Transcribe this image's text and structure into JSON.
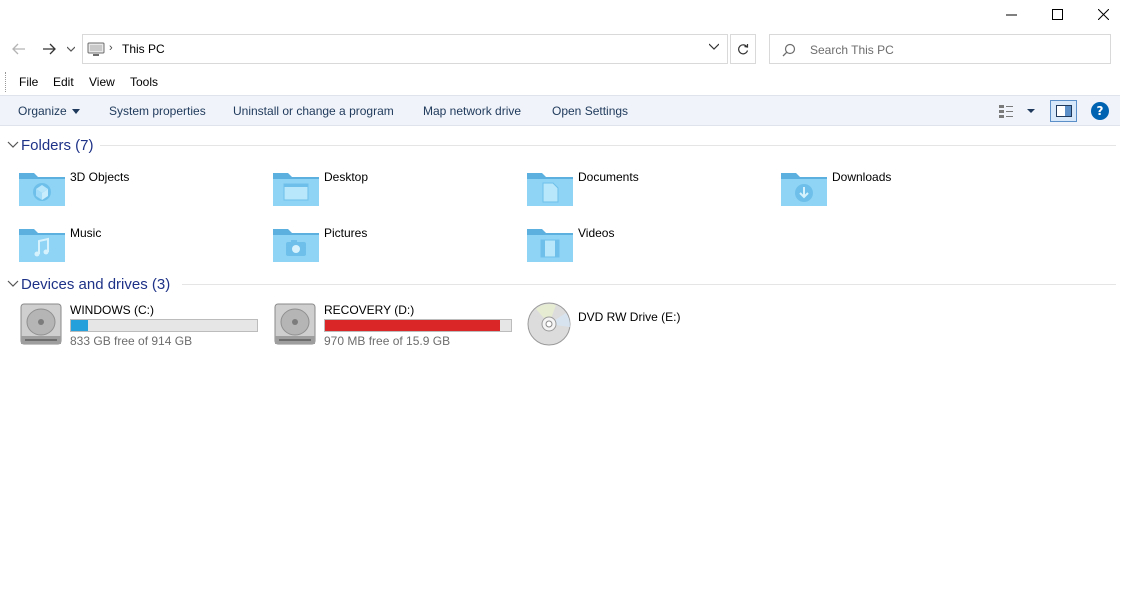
{
  "window": {
    "controls": [
      "minimize",
      "maximize",
      "close"
    ]
  },
  "nav": {
    "back_icon": "arrow-left-icon",
    "forward_icon": "arrow-right-icon",
    "recent_icon": "chevron-down-icon",
    "address": {
      "location": "This PC",
      "icon": "computer-icon"
    },
    "search": {
      "placeholder": "Search This PC"
    }
  },
  "menu": {
    "items": [
      "File",
      "Edit",
      "View",
      "Tools"
    ]
  },
  "toolbar": {
    "organize": "Organize",
    "commands": [
      "System properties",
      "Uninstall or change a program",
      "Map network drive",
      "Open Settings"
    ],
    "help": "?"
  },
  "folders": {
    "title": "Folders (7)",
    "items": [
      {
        "name": "3D Objects",
        "icon": "3d-objects-folder-icon"
      },
      {
        "name": "Desktop",
        "icon": "desktop-folder-icon"
      },
      {
        "name": "Documents",
        "icon": "documents-folder-icon"
      },
      {
        "name": "Downloads",
        "icon": "downloads-folder-icon"
      },
      {
        "name": "Music",
        "icon": "music-folder-icon"
      },
      {
        "name": "Pictures",
        "icon": "pictures-folder-icon"
      },
      {
        "name": "Videos",
        "icon": "videos-folder-icon"
      }
    ]
  },
  "drives": {
    "title": "Devices and drives (3)",
    "items": [
      {
        "name": "WINDOWS (C:)",
        "free": "833 GB free of 914 GB",
        "used_fraction": 0.09,
        "bar_color": "#26a0da",
        "icon": "hard-drive-icon"
      },
      {
        "name": "RECOVERY (D:)",
        "free": "970 MB free of 15.9 GB",
        "used_fraction": 0.94,
        "bar_color": "#da2626",
        "icon": "hard-drive-icon"
      },
      {
        "name": "DVD RW Drive (E:)",
        "icon": "dvd-drive-icon"
      }
    ]
  },
  "colors": {
    "folder": "#6ec6f0",
    "group_title": "#1e3287",
    "accent": "#0063b1"
  }
}
